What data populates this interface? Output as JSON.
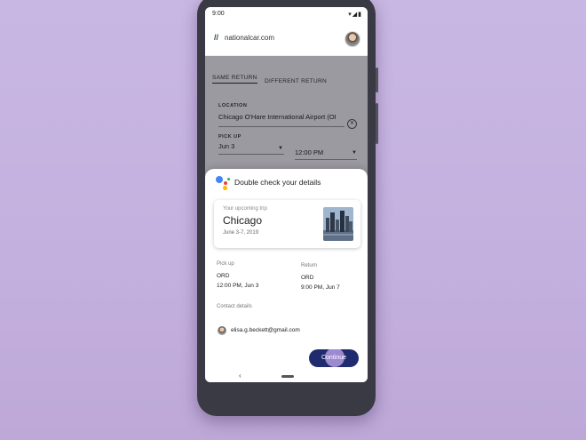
{
  "status_bar": {
    "time": "9:00"
  },
  "app_bar": {
    "domain": "nationalcar.com"
  },
  "form": {
    "tabs": [
      {
        "label": "SAME RETURN",
        "active": true
      },
      {
        "label": "DIFFERENT RETURN",
        "active": false
      }
    ],
    "location": {
      "label": "LOCATION",
      "value": "Chicago O'Hare International Airport (OI"
    },
    "pickup": {
      "label": "PICK UP",
      "date": "Jun 3",
      "time": "12:00 PM"
    }
  },
  "assistant_sheet": {
    "title": "Double check your details",
    "trip": {
      "subtitle": "Your upcoming trip",
      "city": "Chicago",
      "dates": "June 3-7, 2019"
    },
    "pickup": {
      "label": "Pick up",
      "code": "ORD",
      "datetime": "12:00 PM, Jun 3"
    },
    "return": {
      "label": "Return",
      "code": "ORD",
      "datetime": "9:00 PM, Jun 7"
    },
    "contact": {
      "label": "Contact details",
      "email": "elisa.g.beckett@gmail.com"
    },
    "continue_label": "Continue"
  },
  "colors": {
    "background": "#c8b6e2",
    "phone_frame": "#3a3a44",
    "continue_button": "#1f2b6e",
    "assistant_blue": "#4285f4",
    "assistant_red": "#ea4335",
    "assistant_yellow": "#fbbc05",
    "assistant_green": "#34a853"
  }
}
